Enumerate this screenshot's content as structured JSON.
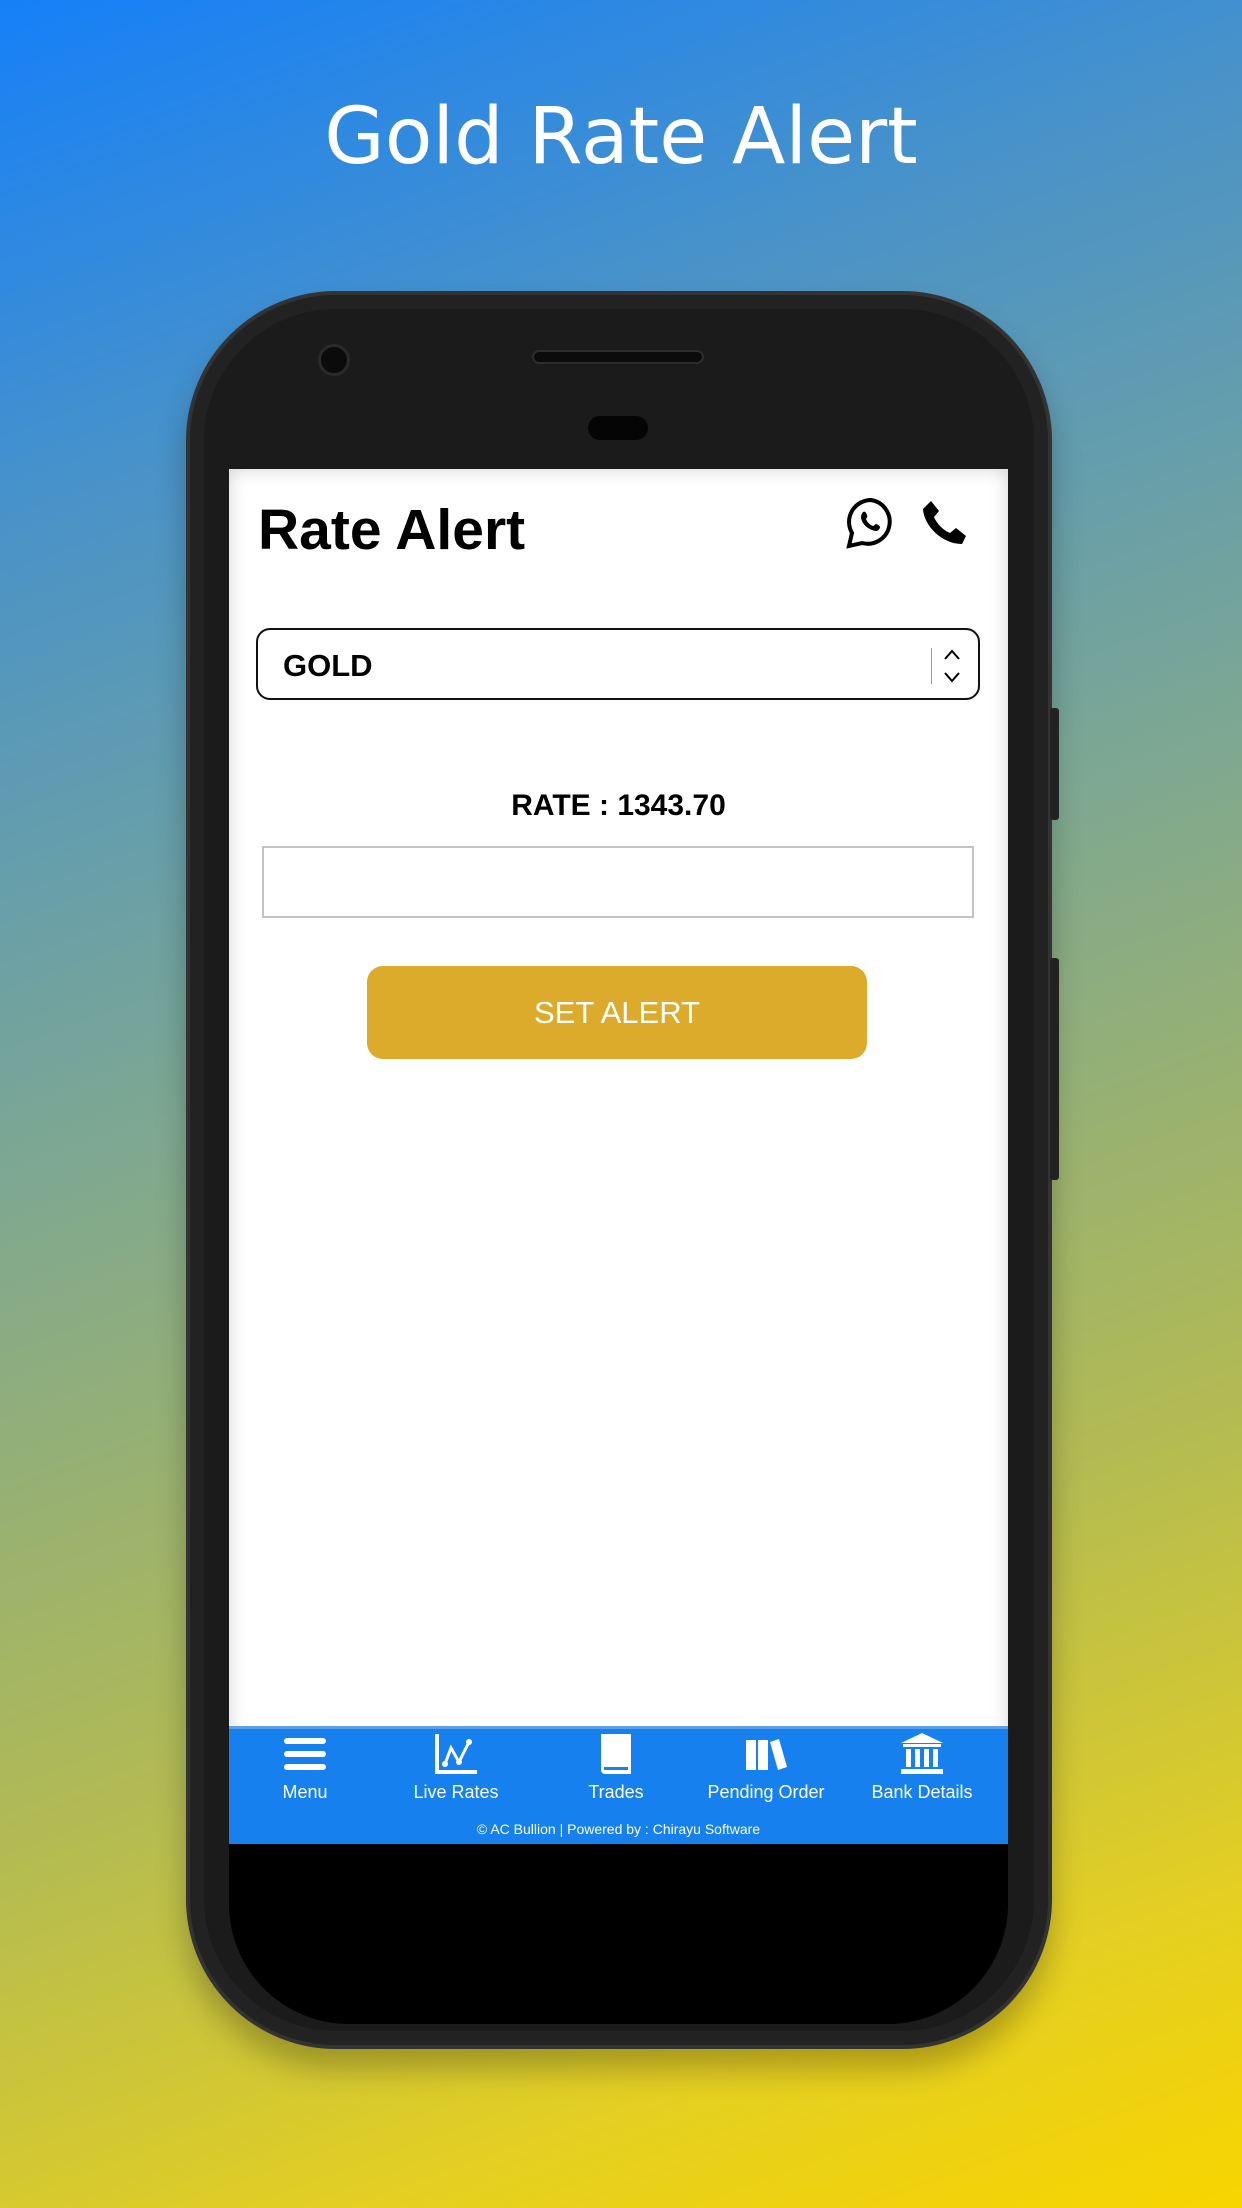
{
  "promo_title": "Gold Rate Alert",
  "header": {
    "title": "Rate Alert",
    "icons": [
      "whatsapp-icon",
      "phone-icon"
    ]
  },
  "form": {
    "metal_select": {
      "value": "GOLD"
    },
    "rate_label": "RATE : 1343.70",
    "rate_input": {
      "value": "",
      "placeholder": ""
    },
    "set_alert_label": "SET ALERT"
  },
  "nav": {
    "items": [
      {
        "label": "Menu",
        "icon": "menu-icon"
      },
      {
        "label": "Live Rates",
        "icon": "chart-icon"
      },
      {
        "label": "Trades",
        "icon": "book-icon"
      },
      {
        "label": "Pending Order",
        "icon": "books-icon"
      },
      {
        "label": "Bank Details",
        "icon": "bank-icon"
      }
    ],
    "footer": "© AC Bullion |  Powered by : Chirayu Software"
  },
  "colors": {
    "accent": "#dcab2b",
    "nav": "#1580ee"
  }
}
